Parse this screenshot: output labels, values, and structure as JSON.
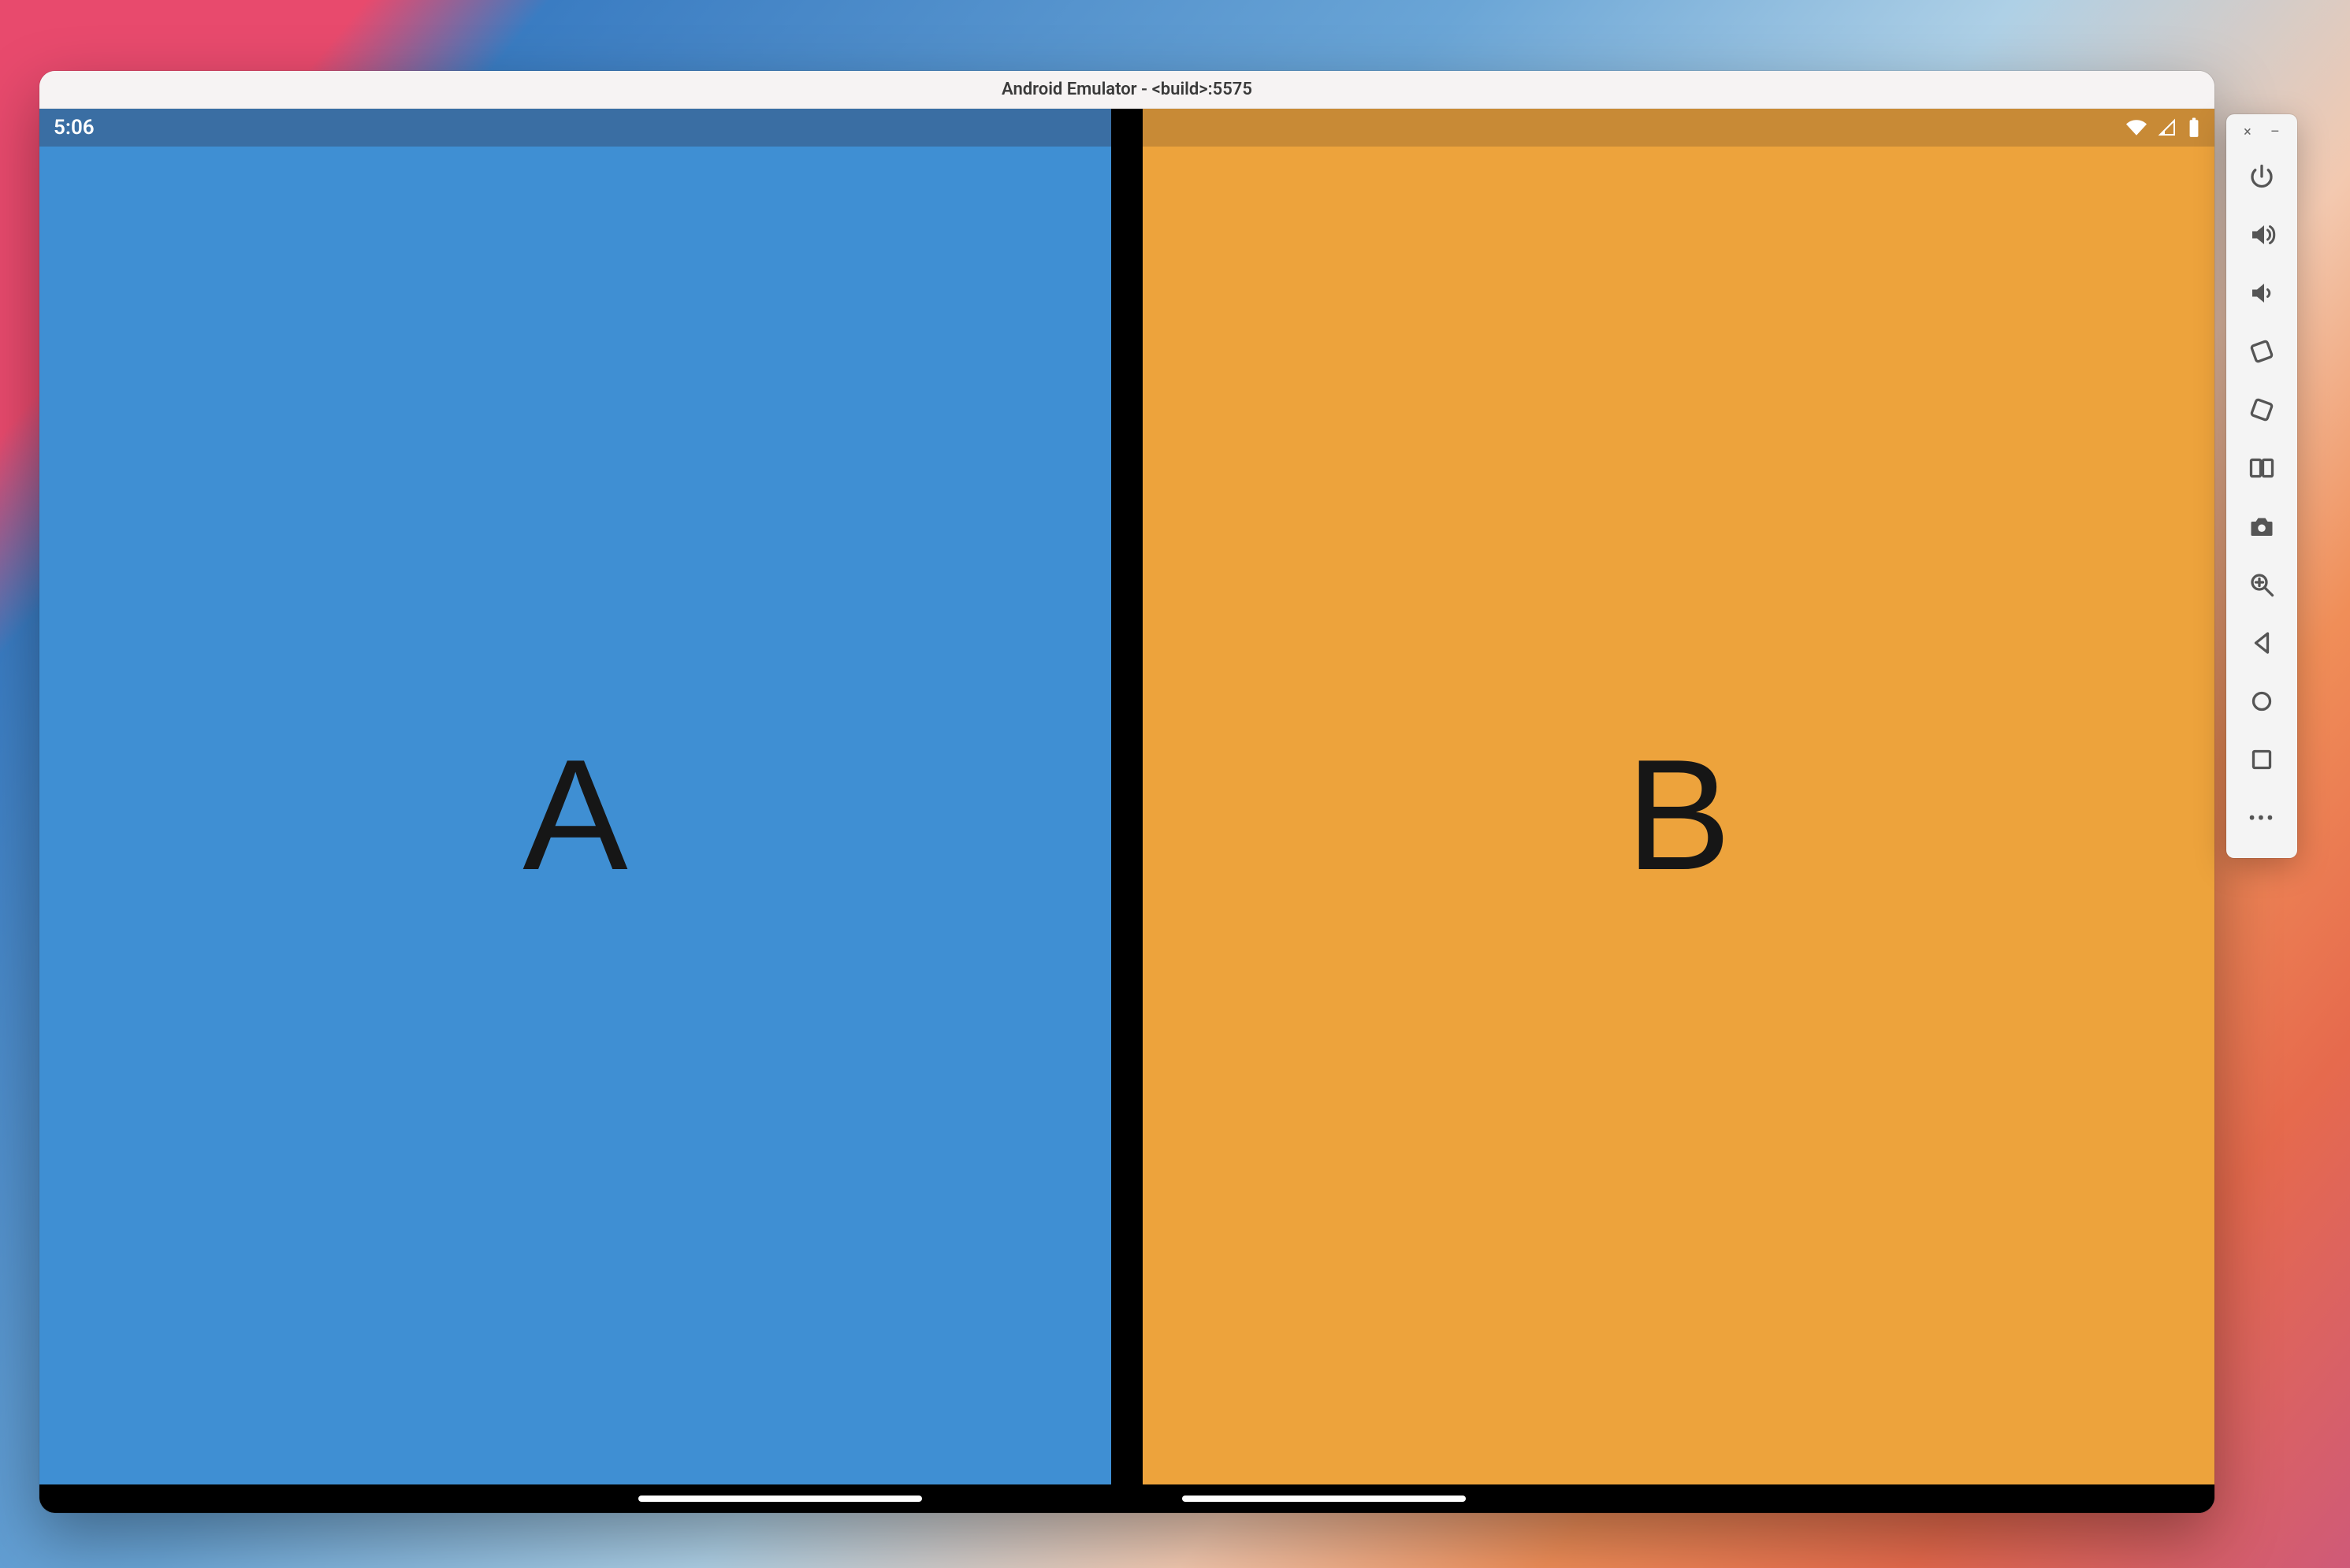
{
  "window": {
    "title": "Android Emulator - <build>:5575"
  },
  "device": {
    "status": {
      "time": "5:06",
      "wifi": "wifi-icon",
      "signal": "signal-icon",
      "battery": "battery-icon"
    },
    "panes": {
      "left": {
        "label": "A",
        "bg": "#3f8fd3",
        "status_bg": "#3a6ea3"
      },
      "right": {
        "label": "B",
        "bg": "#eda33c",
        "status_bg": "#c88a36"
      }
    }
  },
  "toolbar": {
    "header": {
      "close": "×",
      "minimize": "–"
    },
    "buttons": [
      {
        "name": "power-button",
        "icon": "power-icon"
      },
      {
        "name": "volume-up-button",
        "icon": "volume-up-icon"
      },
      {
        "name": "volume-down-button",
        "icon": "volume-down-icon"
      },
      {
        "name": "rotate-left-button",
        "icon": "rotate-left-icon"
      },
      {
        "name": "rotate-right-button",
        "icon": "rotate-right-icon"
      },
      {
        "name": "fold-button",
        "icon": "fold-icon"
      },
      {
        "name": "screenshot-button",
        "icon": "camera-icon"
      },
      {
        "name": "zoom-button",
        "icon": "zoom-in-icon"
      },
      {
        "name": "back-button",
        "icon": "back-icon"
      },
      {
        "name": "home-button",
        "icon": "home-icon"
      },
      {
        "name": "overview-button",
        "icon": "overview-icon"
      },
      {
        "name": "more-button",
        "icon": "more-icon"
      }
    ]
  }
}
